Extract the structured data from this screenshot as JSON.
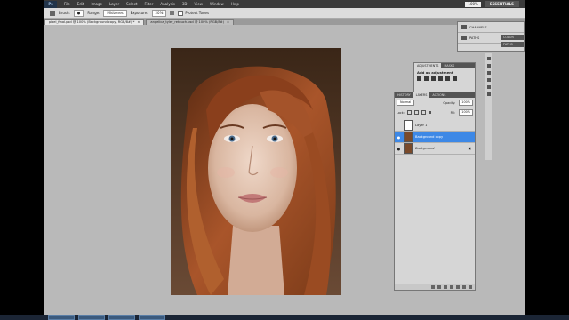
{
  "menubar": {
    "logo": "Ps",
    "items": [
      "File",
      "Edit",
      "Image",
      "Layer",
      "Select",
      "Filter",
      "Analysis",
      "3D",
      "View",
      "Window",
      "Help"
    ],
    "zoom": "100%",
    "workspace": "ESSENTIALS"
  },
  "options": {
    "brush_label": "Brush:",
    "range_label": "Range:",
    "range_value": "Midtones",
    "exposure_label": "Exposure:",
    "exposure_value": "20%",
    "protect_label": "Protect Tones"
  },
  "tabs": [
    {
      "label": "pixel_final.psd @ 100% (Background copy, RGB/8#) *",
      "active": true
    },
    {
      "label": "angelica_tyler_retouch.psd @ 100% (RGB/8#)",
      "active": false
    }
  ],
  "channels_panel": {
    "rows": [
      "CHANNELS",
      "PATHS"
    ],
    "color_tab": "COLOR",
    "paths_tab": "PATHS"
  },
  "adjustments": {
    "tabs": [
      "ADJUSTMENTS",
      "MASKS"
    ],
    "title": "Add an adjustment"
  },
  "layers_panel": {
    "tabs": [
      "HISTORY",
      "LAYERS",
      "ACTIONS"
    ],
    "blend_mode": "Normal",
    "opacity_label": "Opacity:",
    "opacity_value": "100%",
    "lock_label": "Lock:",
    "fill_label": "Fill:",
    "fill_value": "100%",
    "layers": [
      {
        "name": "Layer 1",
        "selected": false,
        "visible": false
      },
      {
        "name": "Background copy",
        "selected": true,
        "visible": true
      },
      {
        "name": "Background",
        "selected": false,
        "visible": true
      }
    ]
  },
  "colors": {
    "selection": "#3d88e6",
    "menubar": "#3a3a3a",
    "canvas": "#b9b9b9"
  }
}
